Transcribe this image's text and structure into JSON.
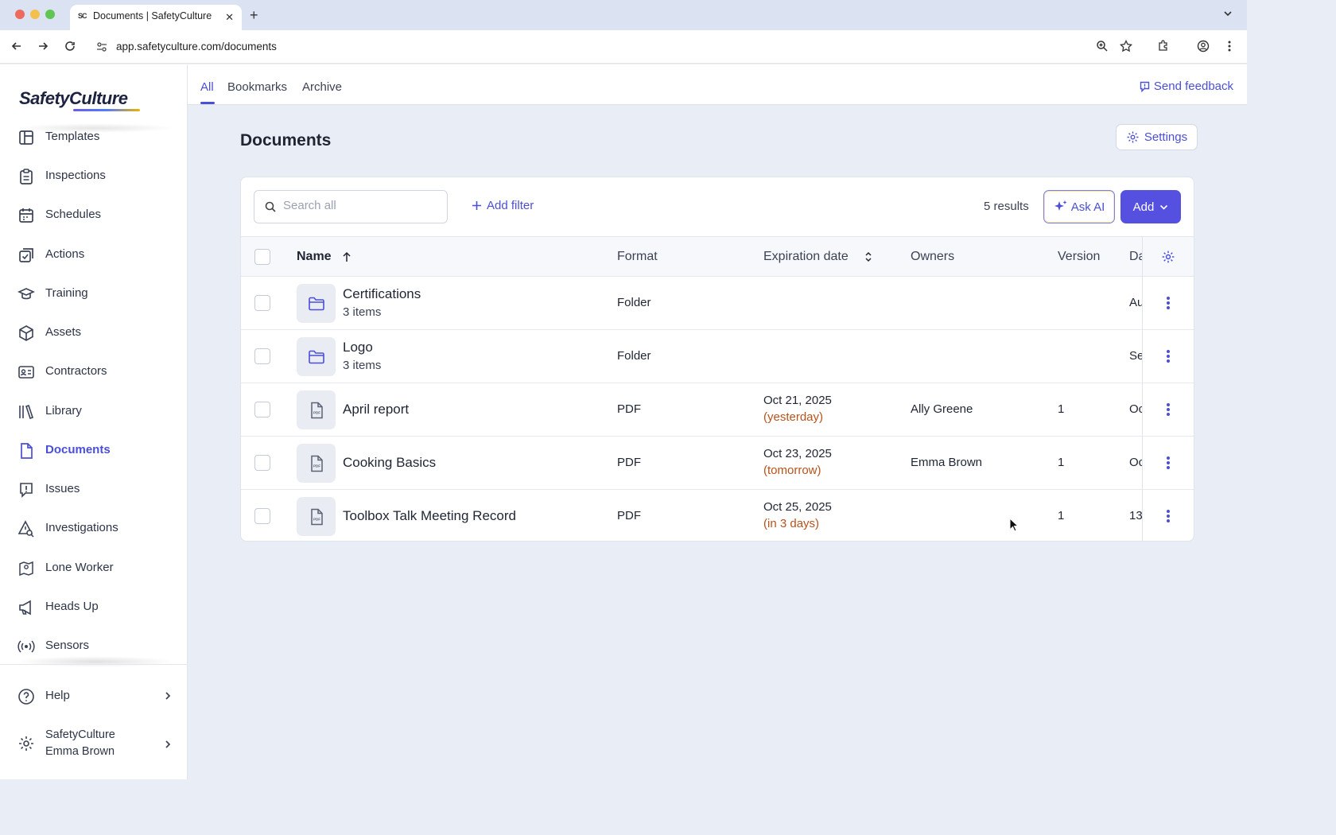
{
  "browser": {
    "tab_title": "Documents | SafetyCulture",
    "tab_favicon": "SC",
    "url": "app.safetyculture.com/documents"
  },
  "sidebar": {
    "logo_text": "SafetyCulture",
    "items": [
      {
        "label": "Templates",
        "icon": "templates-icon"
      },
      {
        "label": "Inspections",
        "icon": "inspections-icon"
      },
      {
        "label": "Schedules",
        "icon": "calendar-icon"
      },
      {
        "label": "Actions",
        "icon": "actions-icon"
      },
      {
        "label": "Training",
        "icon": "graduation-cap-icon"
      },
      {
        "label": "Assets",
        "icon": "cube-icon"
      },
      {
        "label": "Contractors",
        "icon": "id-card-icon"
      },
      {
        "label": "Library",
        "icon": "library-icon"
      },
      {
        "label": "Documents",
        "icon": "document-icon",
        "active": true
      },
      {
        "label": "Issues",
        "icon": "alert-icon"
      },
      {
        "label": "Investigations",
        "icon": "investigation-icon"
      },
      {
        "label": "Lone Worker",
        "icon": "map-pin-icon"
      },
      {
        "label": "Heads Up",
        "icon": "megaphone-icon"
      },
      {
        "label": "Sensors",
        "icon": "sensor-icon"
      }
    ],
    "help_label": "Help",
    "org_name": "SafetyCulture",
    "user_name": "Emma Brown"
  },
  "topnav": {
    "tabs": [
      "All",
      "Bookmarks",
      "Archive"
    ],
    "active_tab": "All",
    "feedback_label": "Send feedback"
  },
  "page": {
    "title": "Documents",
    "settings_label": "Settings"
  },
  "toolbar": {
    "search_placeholder": "Search all",
    "add_filter_label": "Add filter",
    "results_text": "5 results",
    "ask_ai_label": "Ask AI",
    "add_label": "Add"
  },
  "table": {
    "columns": {
      "name": "Name",
      "format": "Format",
      "expiration": "Expiration date",
      "owners": "Owners",
      "version": "Version",
      "date": "Da"
    },
    "rows": [
      {
        "name": "Certifications",
        "sub": "3 items",
        "kind": "folder",
        "format": "Folder",
        "exp_date": "",
        "exp_rel": "",
        "owner": "",
        "version": "",
        "date": "Au"
      },
      {
        "name": "Logo",
        "sub": "3 items",
        "kind": "folder",
        "format": "Folder",
        "exp_date": "",
        "exp_rel": "",
        "owner": "",
        "version": "",
        "date": "Se"
      },
      {
        "name": "April report",
        "sub": "",
        "kind": "pdf",
        "format": "PDF",
        "exp_date": "Oct 21, 2025",
        "exp_rel": "(yesterday)",
        "owner": "Ally Greene",
        "version": "1",
        "date": "Oc"
      },
      {
        "name": "Cooking Basics",
        "sub": "",
        "kind": "pdf",
        "format": "PDF",
        "exp_date": "Oct 23, 2025",
        "exp_rel": "(tomorrow)",
        "owner": "Emma Brown",
        "version": "1",
        "date": "Oc"
      },
      {
        "name": "Toolbox Talk Meeting Record",
        "sub": "",
        "kind": "pdf",
        "format": "PDF",
        "exp_date": "Oct 25, 2025",
        "exp_rel": "(in 3 days)",
        "owner": "",
        "version": "1",
        "date": "13"
      }
    ]
  },
  "colors": {
    "accent": "#4b4fd6",
    "add_button": "#5650e0",
    "relative_date": "#b8521a",
    "background": "#e9edf6"
  }
}
